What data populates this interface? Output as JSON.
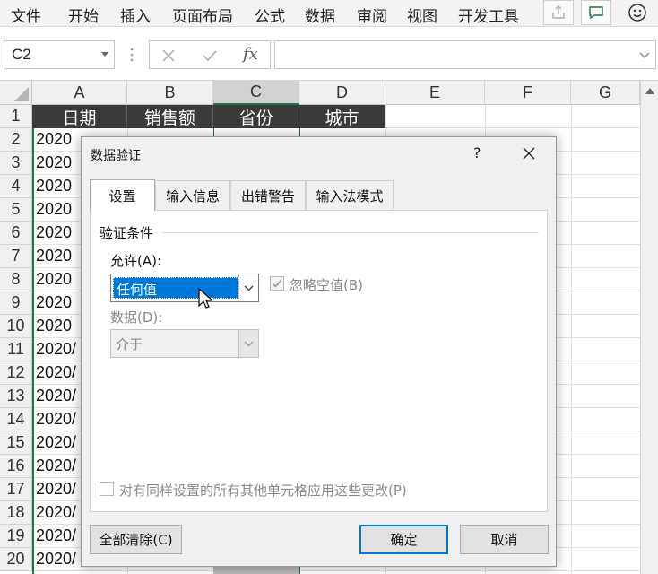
{
  "ribbon": {
    "tabs": [
      "文件",
      "开始",
      "插入",
      "页面布局",
      "公式",
      "数据",
      "审阅",
      "视图",
      "开发工具"
    ],
    "icons": [
      "share-icon",
      "comment-icon",
      "smiley-icon"
    ]
  },
  "formula_bar": {
    "name_box": "C2",
    "fx_label": "fx",
    "formula": ""
  },
  "sheet": {
    "columns": [
      "A",
      "B",
      "C",
      "D",
      "E",
      "F",
      "G"
    ],
    "selected_column": "C",
    "rows": [
      "1",
      "2",
      "3",
      "4",
      "5",
      "6",
      "7",
      "8",
      "9",
      "10",
      "11",
      "12",
      "13",
      "14",
      "15",
      "16",
      "17",
      "18",
      "19",
      "20"
    ],
    "header_cells": [
      "日期",
      "销售额",
      "省份",
      "城市"
    ],
    "col_a_values": [
      "2020",
      "2020",
      "2020",
      "2020",
      "2020",
      "2020",
      "2020",
      "2020",
      "2020",
      "2020/",
      "2020/",
      "2020/",
      "2020/",
      "2020/",
      "2020/",
      "2020/",
      "2020/",
      "2020/",
      "2020/"
    ]
  },
  "dialog": {
    "title": "数据验证",
    "help_label": "?",
    "tabs": [
      "设置",
      "输入信息",
      "出错警告",
      "输入法模式"
    ],
    "active_tab": "设置",
    "section_label": "验证条件",
    "allow_label": "允许(A):",
    "allow_value": "任何值",
    "ignore_blank_label": "忽略空值(B)",
    "ignore_blank_checked": true,
    "data_label": "数据(D):",
    "data_value": "介于",
    "apply_all_label": "对有同样设置的所有其他单元格应用这些更改(P)",
    "apply_all_checked": false,
    "clear_all_label": "全部清除(C)",
    "ok_label": "确定",
    "cancel_label": "取消"
  },
  "colors": {
    "header_fill": "#3a3a3a",
    "selection_blue": "#0078d7",
    "excel_green": "#217346"
  }
}
